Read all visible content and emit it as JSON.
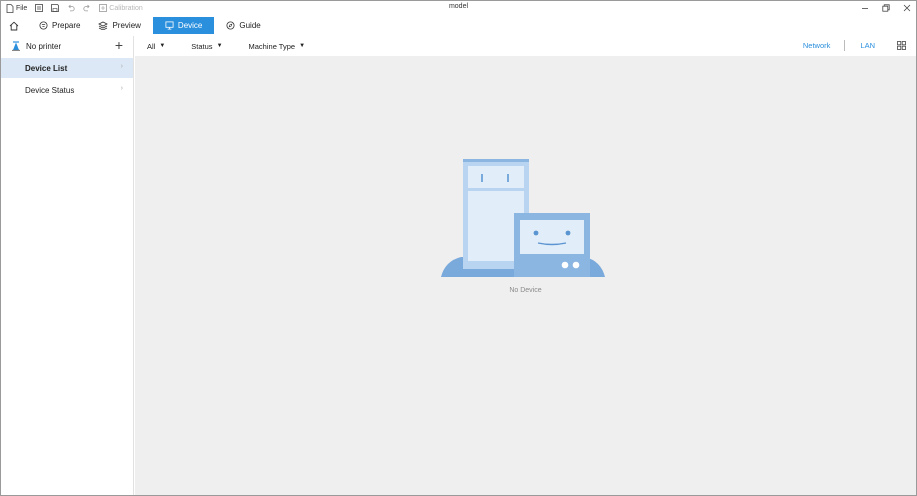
{
  "window": {
    "title": "model",
    "file_label": "File",
    "calibration_label": "Calibration"
  },
  "nav": {
    "tabs": [
      {
        "label": "Prepare",
        "icon": "prepare-icon"
      },
      {
        "label": "Preview",
        "icon": "preview-icon"
      },
      {
        "label": "Device",
        "icon": "device-icon",
        "active": true
      },
      {
        "label": "Guide",
        "icon": "guide-icon"
      }
    ]
  },
  "sidebar": {
    "printer_label": "No printer",
    "add_symbol": "+",
    "items": [
      {
        "label": "Device List",
        "selected": true
      },
      {
        "label": "Device Status",
        "selected": false
      }
    ]
  },
  "filters": {
    "all_label": "All",
    "status_label": "Status",
    "machine_type_label": "Machine Type",
    "network_label": "Network",
    "lan_label": "LAN"
  },
  "main": {
    "empty_text": "No Device"
  },
  "colors": {
    "accent": "#2a8fdd",
    "selected_bg": "#dce8f5",
    "canvas_bg": "#efefef"
  }
}
